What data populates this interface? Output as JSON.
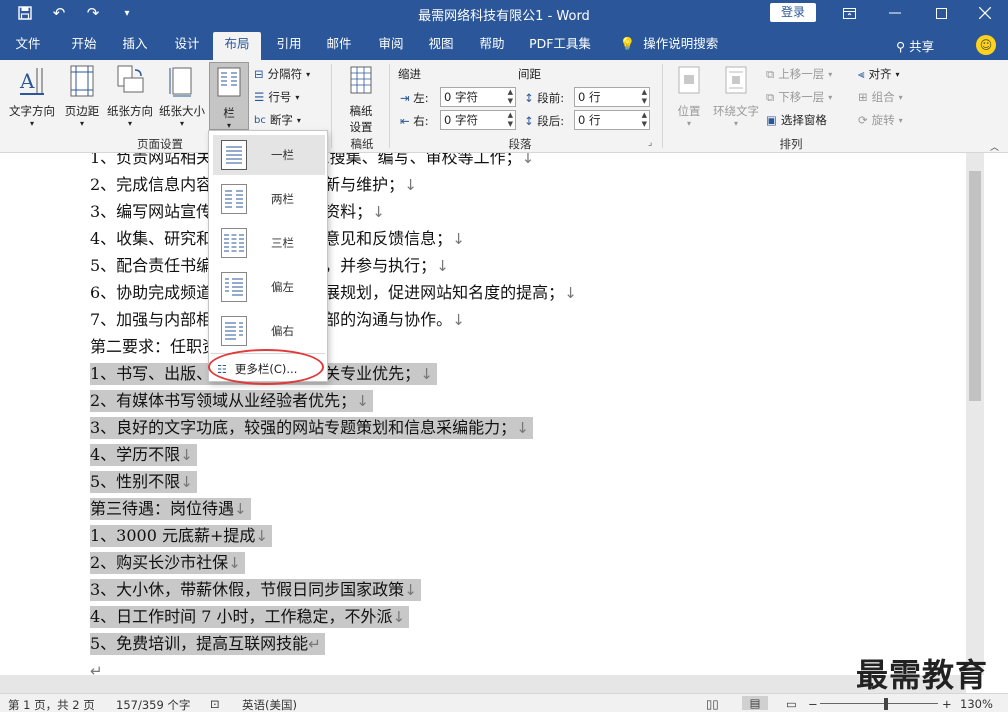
{
  "title_bar": {
    "title": "最需网络科技有限公1 - Word",
    "login": "登录"
  },
  "tabs": [
    "文件",
    "开始",
    "插入",
    "设计",
    "布局",
    "引用",
    "邮件",
    "审阅",
    "视图",
    "帮助",
    "PDF工具集",
    "操作说明搜索"
  ],
  "active_tab": "布局",
  "share": "共享",
  "ribbon": {
    "page_setup": {
      "text_direction": "文字方向",
      "margins": "页边距",
      "orientation": "纸张方向",
      "size": "纸张大小",
      "columns": "栏",
      "breaks": "分隔符",
      "line_numbers": "行号",
      "hyphenation": "断字",
      "label": "页面设置"
    },
    "manuscript": {
      "button": "稿纸\n设置",
      "button_l1": "稿纸",
      "button_l2": "设置",
      "label": "稿纸"
    },
    "paragraph": {
      "indent": "缩进",
      "spacing": "间距",
      "left_label": "左:",
      "right_label": "右:",
      "before_label": "段前:",
      "after_label": "段后:",
      "left_value": "0 字符",
      "right_value": "0 字符",
      "before_value": "0 行",
      "after_value": "0 行",
      "label": "段落"
    },
    "arrange": {
      "position": "位置",
      "wrap_text": "环绕文字",
      "bring_forward": "上移一层",
      "send_backward": "下移一层",
      "selection_pane": "选择窗格",
      "align": "对齐",
      "group": "组合",
      "rotate": "旋转",
      "label": "排列"
    }
  },
  "columns_menu": {
    "items": [
      "一栏",
      "两栏",
      "三栏",
      "偏左",
      "偏右"
    ],
    "more": "更多栏(C)..."
  },
  "document": {
    "lines": [
      {
        "text": "1、负责网站相关栏目/频道的信息搜集、编写、审校等工作；",
        "mark": "↓",
        "selected": false
      },
      {
        "text": "2、完成信息内容的策划和日常更新与维护；",
        "mark": "↓",
        "selected": false
      },
      {
        "text": "3、编写网站宣传资料及相关产品资料；",
        "mark": "↓",
        "selected": false
      },
      {
        "text": "4、收集、研究和处理网络读者的意见和反馈信息；",
        "mark": "↓",
        "selected": false
      },
      {
        "text": "5、配合责任书编辑组织策划活动，并参与执行；",
        "mark": "↓",
        "selected": false
      },
      {
        "text": "6、协助完成频道和栏目相关的发展规划，促进网站知名度的提高；",
        "mark": "↓",
        "selected": false
      },
      {
        "text": "7、加强与内部相关部门和公司外部的沟通与协作。",
        "mark": "↓",
        "selected": false
      },
      {
        "text": "第二要求：任职资格",
        "mark": "",
        "selected": false
      },
      {
        "text": "1、书写、出版、中文、新闻等相关专业优先；",
        "mark": "↓",
        "selected": true
      },
      {
        "text": "2、有媒体书写领域从业经验者优先；",
        "mark": "↓",
        "selected": true
      },
      {
        "text": "3、良好的文字功底，较强的网站专题策划和信息采编能力；",
        "mark": "↓",
        "selected": true
      },
      {
        "text": "4、学历不限",
        "mark": "↓",
        "selected": true
      },
      {
        "text": "5、性别不限",
        "mark": "↓",
        "selected": true
      },
      {
        "text": "第三待遇：岗位待遇",
        "mark": "↓",
        "selected": true
      },
      {
        "text": "1、3000 元底薪+提成",
        "mark": "↓",
        "selected": true
      },
      {
        "text": "2、购买长沙市社保",
        "mark": "↓",
        "selected": true
      },
      {
        "text": "3、大小休，带薪休假，节假日同步国家政策",
        "mark": "↓",
        "selected": true
      },
      {
        "text": "4、日工作时间 7 小时，工作稳定，不外派",
        "mark": "↓",
        "selected": true
      },
      {
        "text": "5、免费培训，提高互联网技能",
        "mark": "↵",
        "selected": true
      },
      {
        "text": "",
        "mark": "↵",
        "selected": false
      }
    ]
  },
  "status_bar": {
    "page": "第 1 页，共 2 页",
    "words": "157/359 个字",
    "language": "英语(美国)",
    "zoom": "130%"
  },
  "watermark": "最需教育",
  "colors": {
    "word_blue": "#2b579a",
    "selection": "#c8c8c8",
    "highlight_ellipse": "#e03a3a"
  }
}
